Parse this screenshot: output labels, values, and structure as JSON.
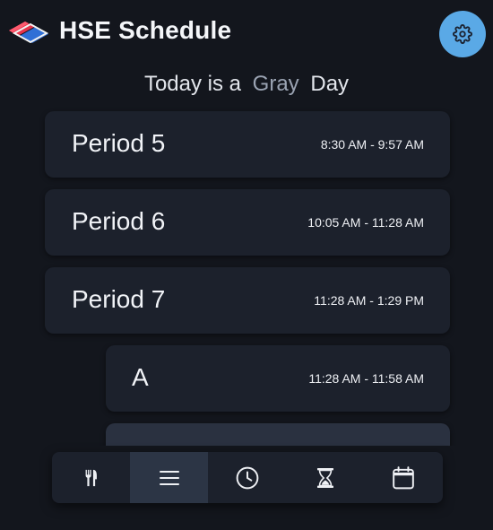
{
  "header": {
    "title": "HSE Schedule",
    "logo_icon": "hse-logo-icon",
    "settings_icon": "gear-icon",
    "settings_color": "#5aa9e6"
  },
  "day": {
    "prefix": "Today is a",
    "color_name": "Gray",
    "suffix": "Day"
  },
  "schedule": {
    "periods": [
      {
        "name": "Period 5",
        "time": "8:30 AM - 9:57 AM"
      },
      {
        "name": "Period 6",
        "time": "10:05 AM - 11:28 AM"
      },
      {
        "name": "Period 7",
        "time": "11:28 AM - 1:29 PM"
      },
      {
        "name": "A",
        "time": "11:28 AM - 11:58 AM"
      }
    ]
  },
  "nav": {
    "items": [
      {
        "icon": "fork-knife-icon",
        "active": false
      },
      {
        "icon": "list-icon",
        "active": true
      },
      {
        "icon": "clock-icon",
        "active": false
      },
      {
        "icon": "hourglass-icon",
        "active": false
      },
      {
        "icon": "calendar-icon",
        "active": false
      }
    ]
  }
}
